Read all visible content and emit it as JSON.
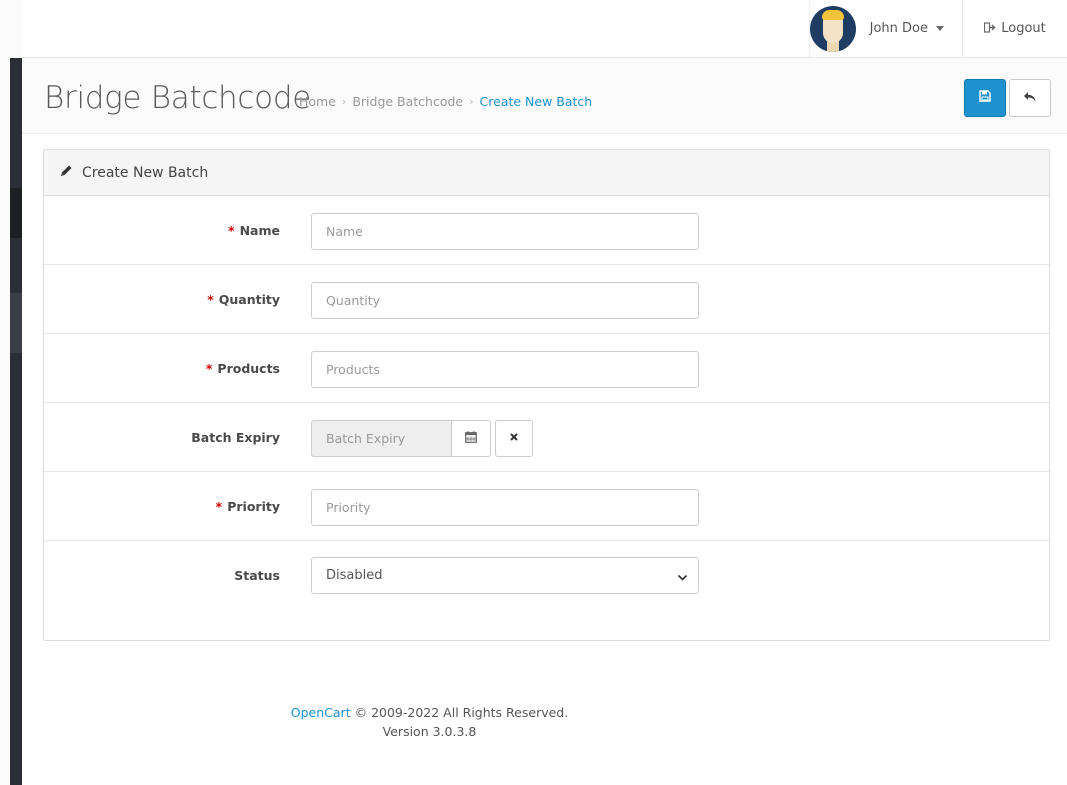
{
  "header": {
    "user_name": "John Doe",
    "logout_label": "Logout"
  },
  "page": {
    "title": "Bridge Batchcode",
    "breadcrumb": [
      "Home",
      "Bridge Batchcode",
      "Create New Batch"
    ]
  },
  "panel": {
    "heading": "Create New Batch",
    "fields": {
      "name": {
        "label": "Name",
        "placeholder": "Name",
        "required": true
      },
      "quantity": {
        "label": "Quantity",
        "placeholder": "Quantity",
        "required": true
      },
      "products": {
        "label": "Products",
        "placeholder": "Products",
        "required": true
      },
      "batch_expiry": {
        "label": "Batch Expiry",
        "placeholder": "Batch Expiry",
        "required": false
      },
      "priority": {
        "label": "Priority",
        "placeholder": "Priority",
        "required": true
      },
      "status": {
        "label": "Status",
        "value": "Disabled"
      }
    }
  },
  "footer": {
    "brand": "OpenCart",
    "copyright": "© 2009-2022 All Rights Reserved.",
    "version": "Version 3.0.3.8"
  },
  "icons": {
    "save": "floppy-disk-icon",
    "back": "reply-arrow-icon",
    "edit": "pencil-icon",
    "calendar": "calendar-icon",
    "clear": "close-icon",
    "logout": "sign-out-icon"
  },
  "colors": {
    "primary": "#1e91cf",
    "required": "#cc0000",
    "sidebar": "#2b2e34"
  }
}
